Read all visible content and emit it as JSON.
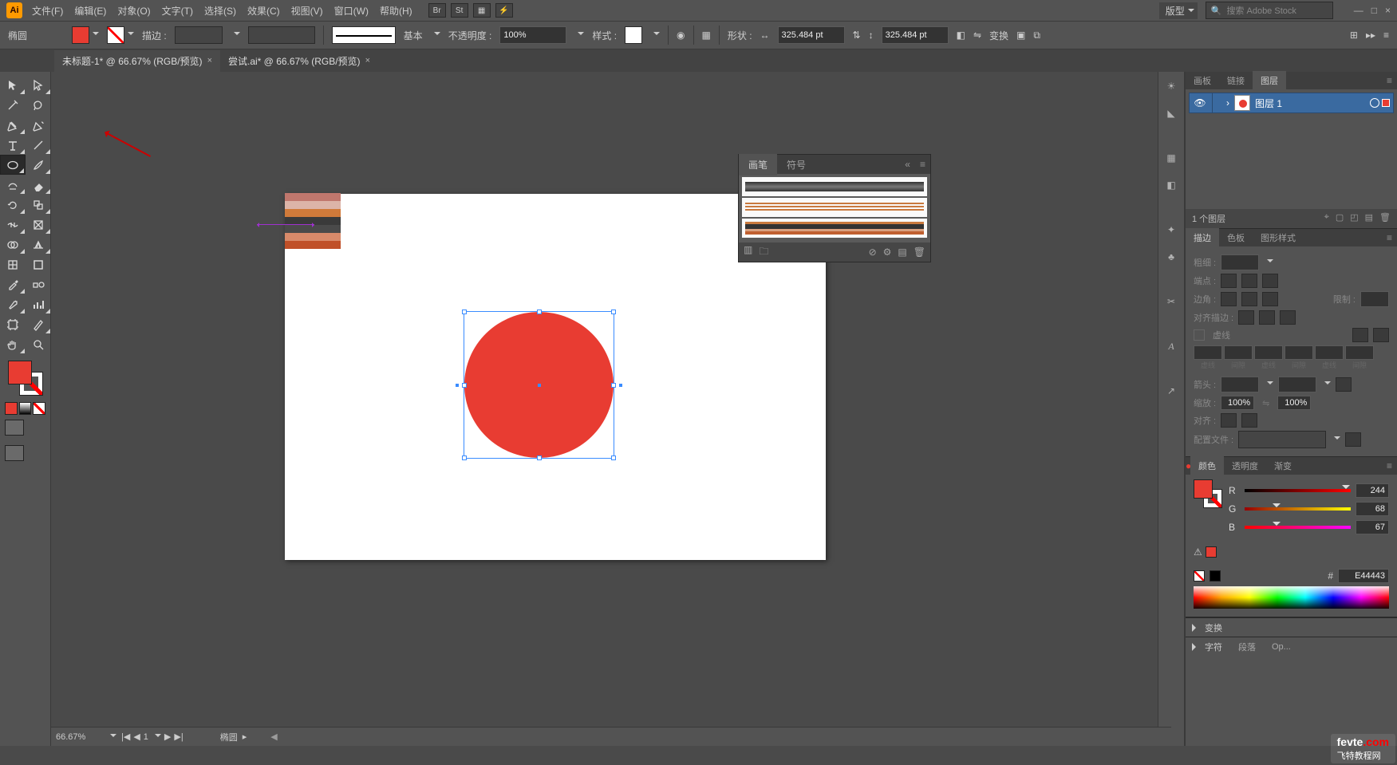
{
  "app": {
    "logo": "Ai"
  },
  "menu": {
    "file": "文件(F)",
    "edit": "编辑(E)",
    "object": "对象(O)",
    "text": "文字(T)",
    "select": "选择(S)",
    "effect": "效果(C)",
    "view": "视图(V)",
    "window": "窗口(W)",
    "help": "帮助(H)"
  },
  "top_icons": {
    "br": "Br",
    "st": "St"
  },
  "workspace": "版型",
  "search": {
    "placeholder": "搜索 Adobe Stock"
  },
  "window_controls": {
    "min": "—",
    "max": "□",
    "close": "×"
  },
  "optionbar": {
    "shape_label": "椭圆",
    "stroke_label": "描边 :",
    "brush_label": "基本",
    "opacity_label": "不透明度 :",
    "opacity_value": "100%",
    "style_label": "样式 :",
    "shape_prop_label": "形状 :",
    "recolor_label": "变换",
    "width_value": "325.484 pt",
    "height_value": "325.484 pt"
  },
  "tabs": {
    "t1": "未标题-1* @ 66.67% (RGB/预览)",
    "t1x": "×",
    "t2": "尝试.ai* @ 66.67% (RGB/预览)",
    "t2x": "×"
  },
  "brush_panel": {
    "tab1": "画笔",
    "tab2": "符号"
  },
  "layers_panel": {
    "tab_artboards": "画板",
    "tab_links": "链接",
    "tab_layers": "图层",
    "layer_name": "图层 1",
    "status": "1 个图层",
    "chev": "›",
    "eye": "👁"
  },
  "stroke_panel": {
    "tab_stroke": "描边",
    "tab_swatches": "色板",
    "tab_graphstyles": "图形样式",
    "weight": "粗细 :",
    "cap": "端点 :",
    "corner": "边角 :",
    "limit": "限制 :",
    "align": "对齐描边 :",
    "dash": "虚线",
    "dashlabels": [
      "虚线",
      "间隙",
      "虚线",
      "间隙",
      "虚线",
      "间隙"
    ],
    "arrow": "箭头 :",
    "scale": "缩放 :",
    "scalev": "100%",
    "alignarrow": "对齐 :",
    "profile": "配置文件 :"
  },
  "color_panel": {
    "tab_color": "颜色",
    "tab_opacity": "透明度",
    "tab_gradient": "渐变",
    "r": "R",
    "g": "G",
    "b": "B",
    "r_val": "244",
    "g_val": "68",
    "b_val": "67",
    "hash": "#",
    "hex": "E44443"
  },
  "collapse": {
    "transform": "变换",
    "character": "字符",
    "paragraph": "段落",
    "opentype": "Op..."
  },
  "statusbar": {
    "zoom": "66.67%",
    "page": "1",
    "status": "椭圆",
    "nav_first": "|◀",
    "nav_prev": "◀",
    "nav_next": "▶",
    "nav_last": "▶|"
  },
  "watermark": {
    "site": "飞特教程网",
    "url": "fevte",
    "dot": ".com"
  }
}
